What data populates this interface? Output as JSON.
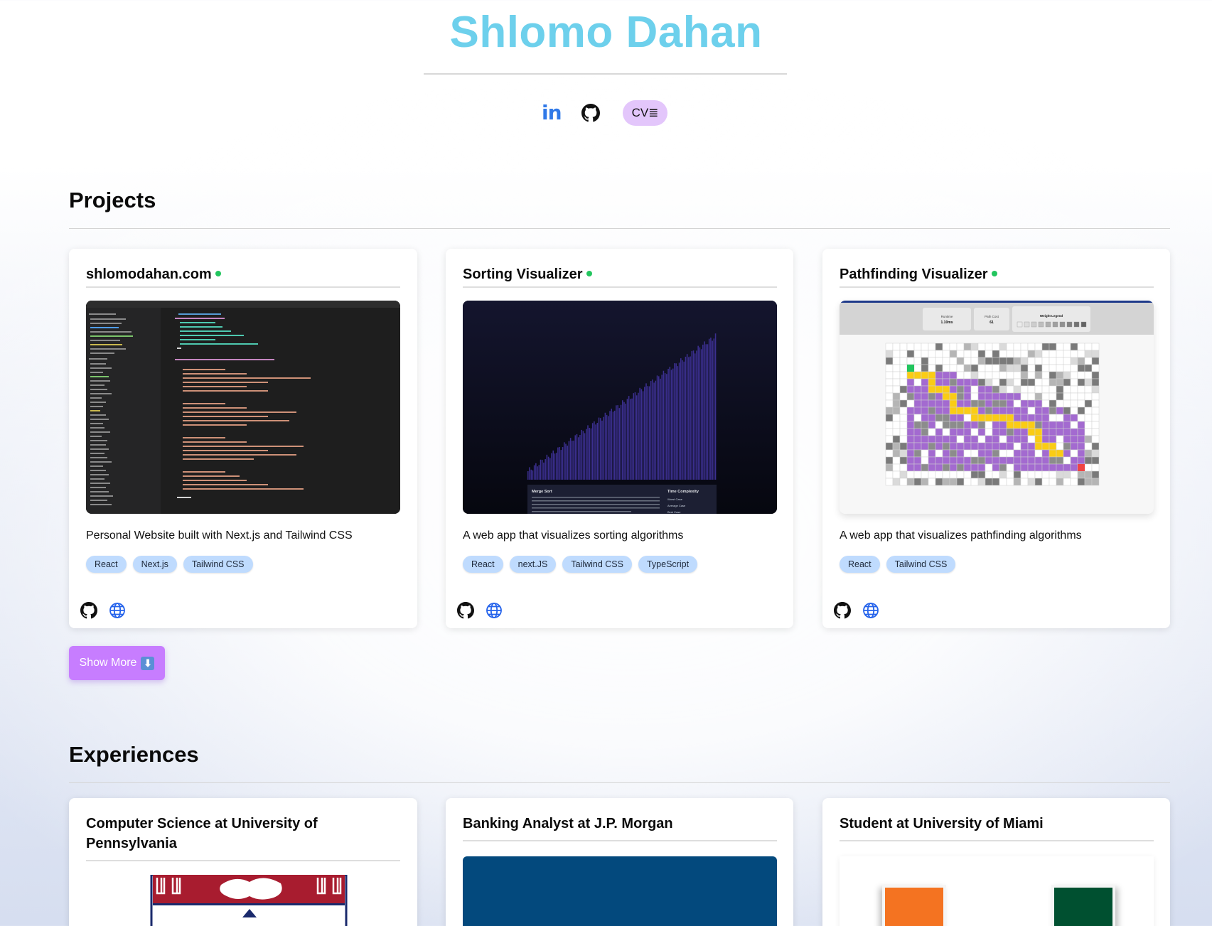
{
  "header": {
    "name": "Shlomo Dahan",
    "social": {
      "linkedin_label": "in",
      "cv_label": "CV≣"
    }
  },
  "projects": {
    "heading": "Projects",
    "cards": [
      {
        "title": "shlomodahan.com",
        "description": "Personal Website built with Next.js and Tailwind CSS",
        "tags": [
          "React",
          "Next.js",
          "Tailwind CSS"
        ],
        "status_color": "#22c55e"
      },
      {
        "title": "Sorting Visualizer",
        "description": "A web app that visualizes sorting algorithms",
        "tags": [
          "React",
          "next.JS",
          "Tailwind CSS",
          "TypeScript"
        ],
        "status_color": "#22c55e",
        "screenshot_text": {
          "panel_title": "Merge Sort",
          "panel_right_title": "Time Complexity",
          "rows": [
            "Worst Case",
            "Average Case",
            "Best Case"
          ]
        }
      },
      {
        "title": "Pathfinding Visualizer",
        "description": "A web app that visualizes pathfinding algorithms",
        "tags": [
          "React",
          "Tailwind CSS"
        ],
        "status_color": "#22c55e",
        "screenshot_text": {
          "runtime_label": "Runtime",
          "runtime_value": "1.10ms",
          "pathcost_label": "Path Cost",
          "pathcost_value": "61",
          "legend_label": "Weight Legend"
        }
      }
    ],
    "show_more_label": "Show More",
    "show_more_icon": "⬇"
  },
  "experiences": {
    "heading": "Experiences",
    "cards": [
      {
        "title": "Computer Science at University of Pennsylvania"
      },
      {
        "title": "Banking Analyst at J.P. Morgan"
      },
      {
        "title": "Student at University of Miami"
      }
    ]
  },
  "colors": {
    "title": "#6dd0ec",
    "accent_purple": "#c77dff",
    "cv_pill": "#e3c6fb",
    "tag_bg": "#bfdbfe",
    "linkedin": "#3079e8",
    "status_green": "#22c55e",
    "jpm_blue": "#03497d",
    "penn_red": "#a81c2f",
    "um_orange": "#f47321",
    "um_green": "#005030"
  },
  "icons": [
    "linkedin-icon",
    "github-icon",
    "globe-icon",
    "download-icon"
  ]
}
